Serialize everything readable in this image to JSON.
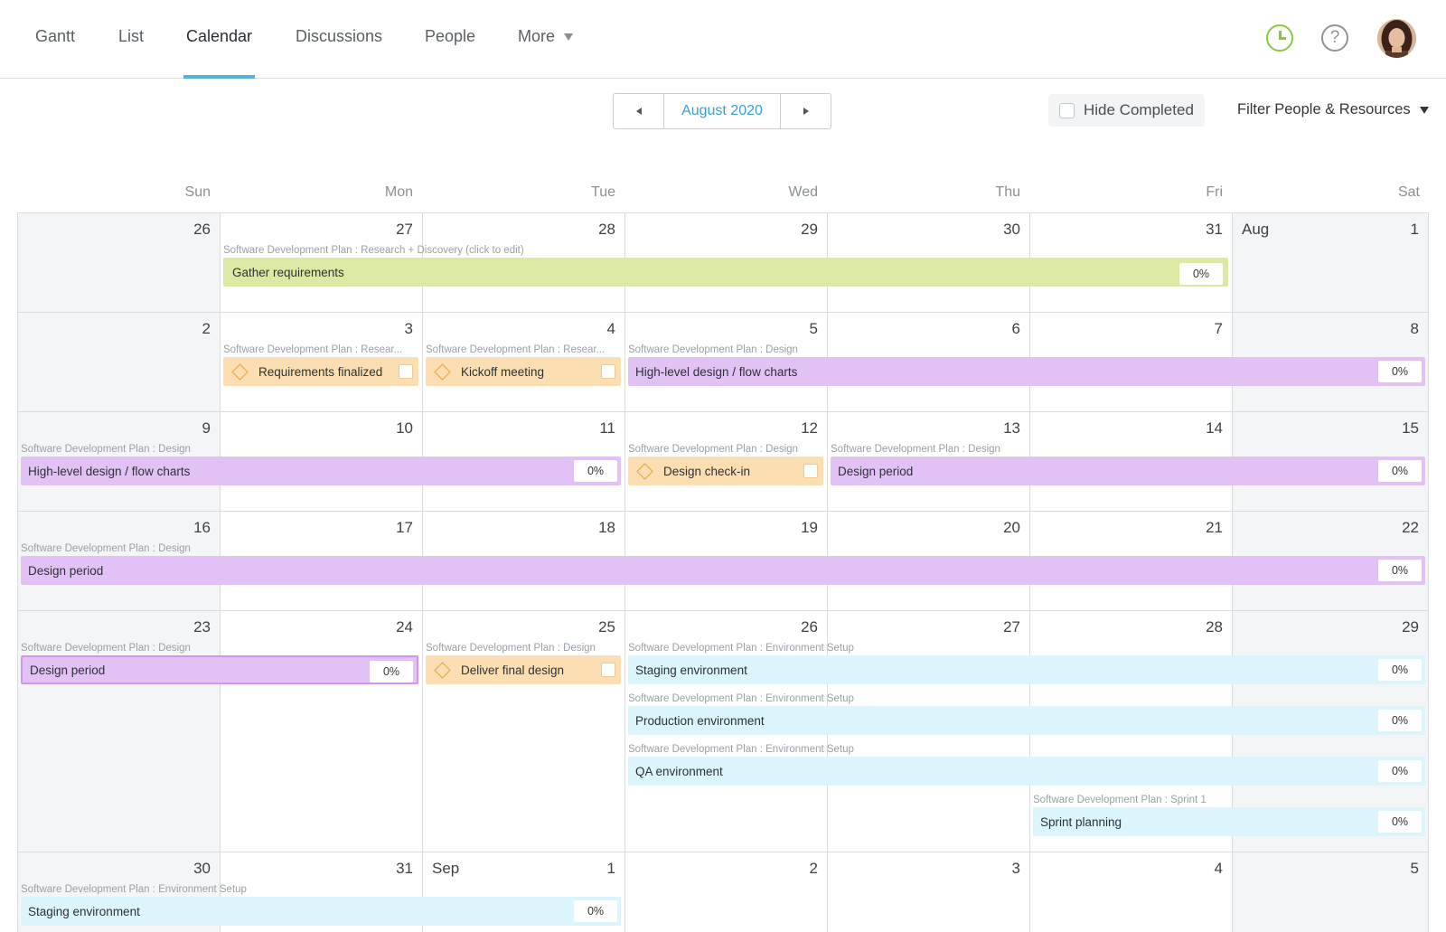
{
  "nav": {
    "tabs": [
      "Gantt",
      "List",
      "Calendar",
      "Discussions",
      "People",
      "More"
    ],
    "active": "Calendar"
  },
  "icons": {
    "time": "clock-icon",
    "help": "help-icon",
    "user": "avatar"
  },
  "help_glyph": "?",
  "toolbar": {
    "month": "August 2020",
    "hide_completed": "Hide Completed",
    "filter": "Filter People & Resources"
  },
  "weekdays": [
    "Sun",
    "Mon",
    "Tue",
    "Wed",
    "Thu",
    "Fri",
    "Sat"
  ],
  "weeks": [
    {
      "days": [
        "26",
        "27",
        "28",
        "29",
        "30",
        "31",
        "1"
      ],
      "month_labels": {
        "6": "Aug"
      }
    },
    {
      "days": [
        "2",
        "3",
        "4",
        "5",
        "6",
        "7",
        "8"
      ]
    },
    {
      "days": [
        "9",
        "10",
        "11",
        "12",
        "13",
        "14",
        "15"
      ]
    },
    {
      "days": [
        "16",
        "17",
        "18",
        "19",
        "20",
        "21",
        "22"
      ]
    },
    {
      "days": [
        "23",
        "24",
        "25",
        "26",
        "27",
        "28",
        "29"
      ]
    },
    {
      "days": [
        "30",
        "31",
        "1",
        "2",
        "3",
        "4",
        "5"
      ],
      "month_labels": {
        "2": "Sep"
      }
    }
  ],
  "events": [
    {
      "week": 0,
      "start": 1,
      "span": 5,
      "row": 0,
      "type": "task",
      "color": "green",
      "label": "Software Development Plan : Research + Discovery (click to edit)",
      "title": "Gather requirements",
      "pct": "0%"
    },
    {
      "week": 1,
      "start": 1,
      "span": 1,
      "row": 0,
      "type": "milestone",
      "label": "Software Development Plan : Resear...",
      "title": "Requirements finalized"
    },
    {
      "week": 1,
      "start": 2,
      "span": 1,
      "row": 0,
      "type": "milestone",
      "label": "Software Development Plan : Resear...",
      "title": "Kickoff meeting"
    },
    {
      "week": 1,
      "start": 3,
      "span": 4,
      "row": 0,
      "type": "task",
      "color": "purple",
      "label": "Software Development Plan : Design",
      "title": "High-level design / flow charts",
      "pct": "0%"
    },
    {
      "week": 2,
      "start": 0,
      "span": 3,
      "row": 0,
      "type": "task",
      "color": "purple",
      "label": "Software Development Plan : Design",
      "title": "High-level design / flow charts",
      "pct": "0%"
    },
    {
      "week": 2,
      "start": 3,
      "span": 1,
      "row": 0,
      "type": "milestone",
      "label": "Software Development Plan : Design",
      "title": "Design check-in"
    },
    {
      "week": 2,
      "start": 4,
      "span": 3,
      "row": 0,
      "type": "task",
      "color": "purple",
      "label": "Software Development Plan : Design",
      "title": "Design period",
      "pct": "0%"
    },
    {
      "week": 3,
      "start": 0,
      "span": 7,
      "row": 0,
      "type": "task",
      "color": "purple",
      "label": "Software Development Plan : Design",
      "title": "Design period",
      "pct": "0%"
    },
    {
      "week": 4,
      "start": 0,
      "span": 2,
      "row": 0,
      "type": "task",
      "color": "purple-outline",
      "label": "Software Development Plan : Design",
      "title": "Design period",
      "pct": "0%"
    },
    {
      "week": 4,
      "start": 2,
      "span": 1,
      "row": 0,
      "type": "milestone",
      "label": "Software Development Plan : Design",
      "title": "Deliver final design"
    },
    {
      "week": 4,
      "start": 3,
      "span": 4,
      "row": 0,
      "type": "task",
      "color": "cyan",
      "label": "Software Development Plan : Environment Setup",
      "title": "Staging environment",
      "pct": "0%"
    },
    {
      "week": 4,
      "start": 3,
      "span": 4,
      "row": 1,
      "type": "task",
      "color": "cyan",
      "label": "Software Development Plan : Environment Setup",
      "title": "Production environment",
      "pct": "0%"
    },
    {
      "week": 4,
      "start": 3,
      "span": 4,
      "row": 2,
      "type": "task",
      "color": "cyan",
      "label": "Software Development Plan : Environment Setup",
      "title": "QA environment",
      "pct": "0%"
    },
    {
      "week": 4,
      "start": 5,
      "span": 2,
      "row": 3,
      "type": "task",
      "color": "cyan",
      "label": "Software Development Plan : Sprint 1",
      "title": "Sprint planning",
      "pct": "0%"
    },
    {
      "week": 5,
      "start": 0,
      "span": 3,
      "row": 0,
      "type": "task",
      "color": "cyan",
      "label": "Software Development Plan : Environment Setup",
      "title": "Staging environment",
      "pct": "0%"
    }
  ]
}
